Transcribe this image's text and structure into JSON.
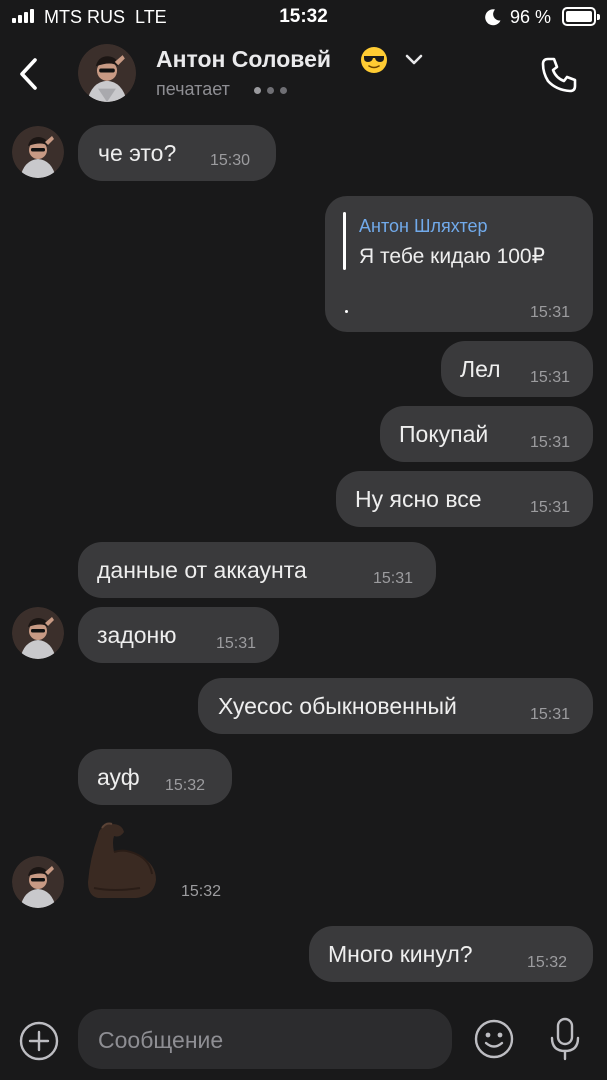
{
  "status_bar": {
    "carrier": "MTS RUS",
    "network": "LTE",
    "time": "15:32",
    "battery": "96 %"
  },
  "header": {
    "contact_name": "Антон Соловей",
    "status": "печатает",
    "emoji_icon": "sunglasses-emoji-icon"
  },
  "messages": [
    {
      "side": "in",
      "text": "че это?",
      "time": "15:30"
    },
    {
      "side": "out",
      "reply_author": "Антон Шляхтер",
      "reply_text": "Я тебе кидаю 100₽",
      "time": "15:31"
    },
    {
      "side": "out",
      "text": "Лел",
      "time": "15:31"
    },
    {
      "side": "out",
      "text": "Покупай",
      "time": "15:31"
    },
    {
      "side": "out",
      "text": "Ну ясно все",
      "time": "15:31"
    },
    {
      "side": "in",
      "text": "данные от аккаунта",
      "time": "15:31"
    },
    {
      "side": "in",
      "text": "задоню",
      "time": "15:31"
    },
    {
      "side": "out",
      "text": "Хуесос обыкновенный",
      "time": "15:31"
    },
    {
      "side": "in",
      "text": "ауф",
      "time": "15:32"
    },
    {
      "side": "in",
      "sticker": "flexed-biceps-emoji-icon",
      "time": "15:32"
    },
    {
      "side": "out",
      "text": "Много кинул?",
      "time": "15:32"
    }
  ],
  "composer": {
    "placeholder": "Сообщение"
  },
  "colors": {
    "background": "#19191a",
    "bubble": "#3a3a3c",
    "accent_link": "#71aaeb",
    "time_text": "#9c9c9f"
  }
}
